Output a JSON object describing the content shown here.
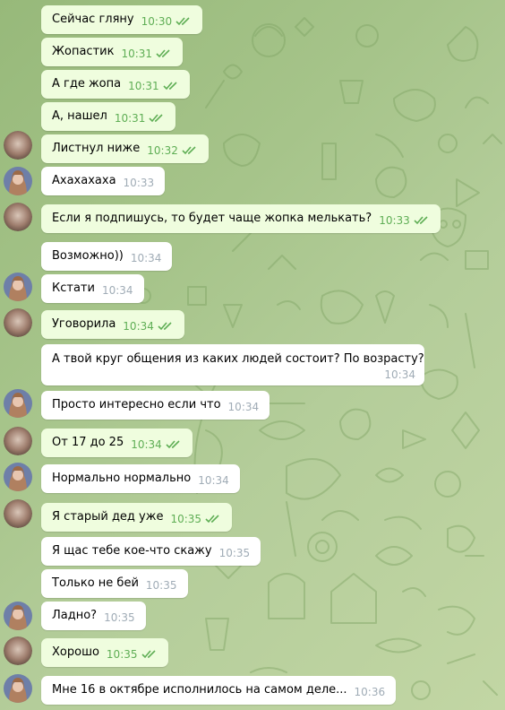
{
  "chat": {
    "messages": [
      {
        "text": "Сейчас гляну",
        "time": "10:30",
        "dir": "out",
        "avatar": "none"
      },
      {
        "text": "Жопастик",
        "time": "10:31",
        "dir": "out",
        "avatar": "none"
      },
      {
        "text": "А где жопа",
        "time": "10:31",
        "dir": "out",
        "avatar": "none"
      },
      {
        "text": "А, нашел",
        "time": "10:31",
        "dir": "out",
        "avatar": "none"
      },
      {
        "text": "Листнул ниже",
        "time": "10:32",
        "dir": "out",
        "avatar": "blurred-avatar"
      },
      {
        "text": "Ахахахаха",
        "time": "10:33",
        "dir": "in",
        "avatar": "girl-avatar"
      },
      {
        "text": "Если я подпишусь, то будет чаще жопка мелькать?",
        "time": "10:33",
        "dir": "out",
        "avatar": "blurred-avatar"
      },
      {
        "text": "Возможно))",
        "time": "10:34",
        "dir": "in",
        "avatar": "none"
      },
      {
        "text": "Кстати",
        "time": "10:34",
        "dir": "in",
        "avatar": "girl-avatar"
      },
      {
        "text": "Уговорила",
        "time": "10:34",
        "dir": "out",
        "avatar": "blurred-avatar"
      },
      {
        "text": "А твой круг общения из каких людей состоит? По возрасту?",
        "time": "10:34",
        "dir": "in",
        "avatar": "none"
      },
      {
        "text": "Просто интересно если что",
        "time": "10:34",
        "dir": "in",
        "avatar": "girl-avatar"
      },
      {
        "text": "От 17 до 25",
        "time": "10:34",
        "dir": "out",
        "avatar": "blurred-avatar"
      },
      {
        "text": "Нормально нормально",
        "time": "10:34",
        "dir": "in",
        "avatar": "girl-avatar"
      },
      {
        "text": "Я старый дед уже",
        "time": "10:35",
        "dir": "out",
        "avatar": "blurred-avatar"
      },
      {
        "text": "Я щас тебе кое-что скажу",
        "time": "10:35",
        "dir": "in",
        "avatar": "none"
      },
      {
        "text": "Только не бей",
        "time": "10:35",
        "dir": "in",
        "avatar": "none"
      },
      {
        "text": "Ладно?",
        "time": "10:35",
        "dir": "in",
        "avatar": "girl-avatar"
      },
      {
        "text": "Хорошо",
        "time": "10:35",
        "dir": "out",
        "avatar": "blurred-avatar"
      },
      {
        "text": "Мне 16 в октябре исполнилось на самом деле...",
        "time": "10:36",
        "dir": "in",
        "avatar": "girl-avatar"
      }
    ]
  },
  "colors": {
    "outgoing_bubble": "#effdde",
    "incoming_bubble": "#ffffff",
    "read_check": "#5fae55",
    "incoming_time": "#a0acb6"
  },
  "icons": {
    "read_status": "double-check-icon"
  }
}
